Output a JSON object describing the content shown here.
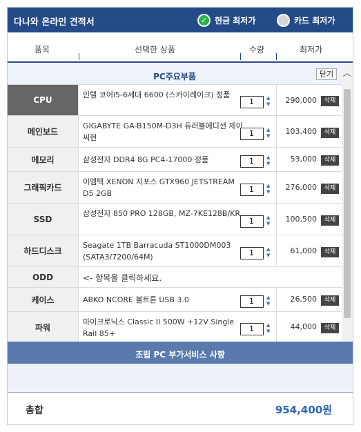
{
  "header": {
    "title": "다나와 온라인 견적서",
    "cash_label": "현금 최저가",
    "card_label": "카드 최저가",
    "check_glyph": "✓"
  },
  "columns": {
    "category": "품목",
    "product": "선택한 상품",
    "qty": "수량",
    "price": "최저가"
  },
  "section": {
    "title": "PC주요부품",
    "close_label": "닫기"
  },
  "scroll_up_icon": "︿",
  "delete_label": "삭제",
  "items": [
    {
      "category": "CPU",
      "product": "인텔 코어i5-6세대 6600 (스카이레이크) 정품",
      "qty": "1",
      "price": "290,000"
    },
    {
      "category": "메인보드",
      "product": "GIGABYTE GA-B150M-D3H 듀러블에디션 제이씨현",
      "qty": "1",
      "price": "103,400"
    },
    {
      "category": "메모리",
      "product": "삼성전자 DDR4 8G PC4-17000 정품",
      "qty": "1",
      "price": "53,000"
    },
    {
      "category": "그래픽카드",
      "product": "이엠텍 XENON 지포스 GTX960 JETSTREAM D5 2GB",
      "qty": "1",
      "price": "276,000"
    },
    {
      "category": "SSD",
      "product": "삼성전자 850 PRO 128GB, MZ-7KE128B/KR",
      "qty": "1",
      "price": "100,500"
    },
    {
      "category": "하드디스크",
      "product": "Seagate 1TB Barracuda ST1000DM003 (SATA3/7200/64M)",
      "qty": "1",
      "price": "61,000"
    },
    {
      "category": "ODD",
      "hint": "<- 항목을 클릭하세요."
    },
    {
      "category": "케이스",
      "product": "ABKO NCORE 볼트론 USB 3.0",
      "qty": "1",
      "price": "26,500"
    },
    {
      "category": "파워",
      "product": "마이크로닉스 Classic II 500W +12V Single Rail 85+",
      "qty": "1",
      "price": "44,000"
    }
  ],
  "service": {
    "title": "조립 PC 부가서비스 사항"
  },
  "total": {
    "label": "총합",
    "value": "954,400원"
  },
  "colors": {
    "header_bg": "#244a87",
    "active_category_bg": "#666666",
    "service_bar_bg": "#5a7aae",
    "total_value": "#2e66b5",
    "radio_checked": "#2bb34a"
  }
}
